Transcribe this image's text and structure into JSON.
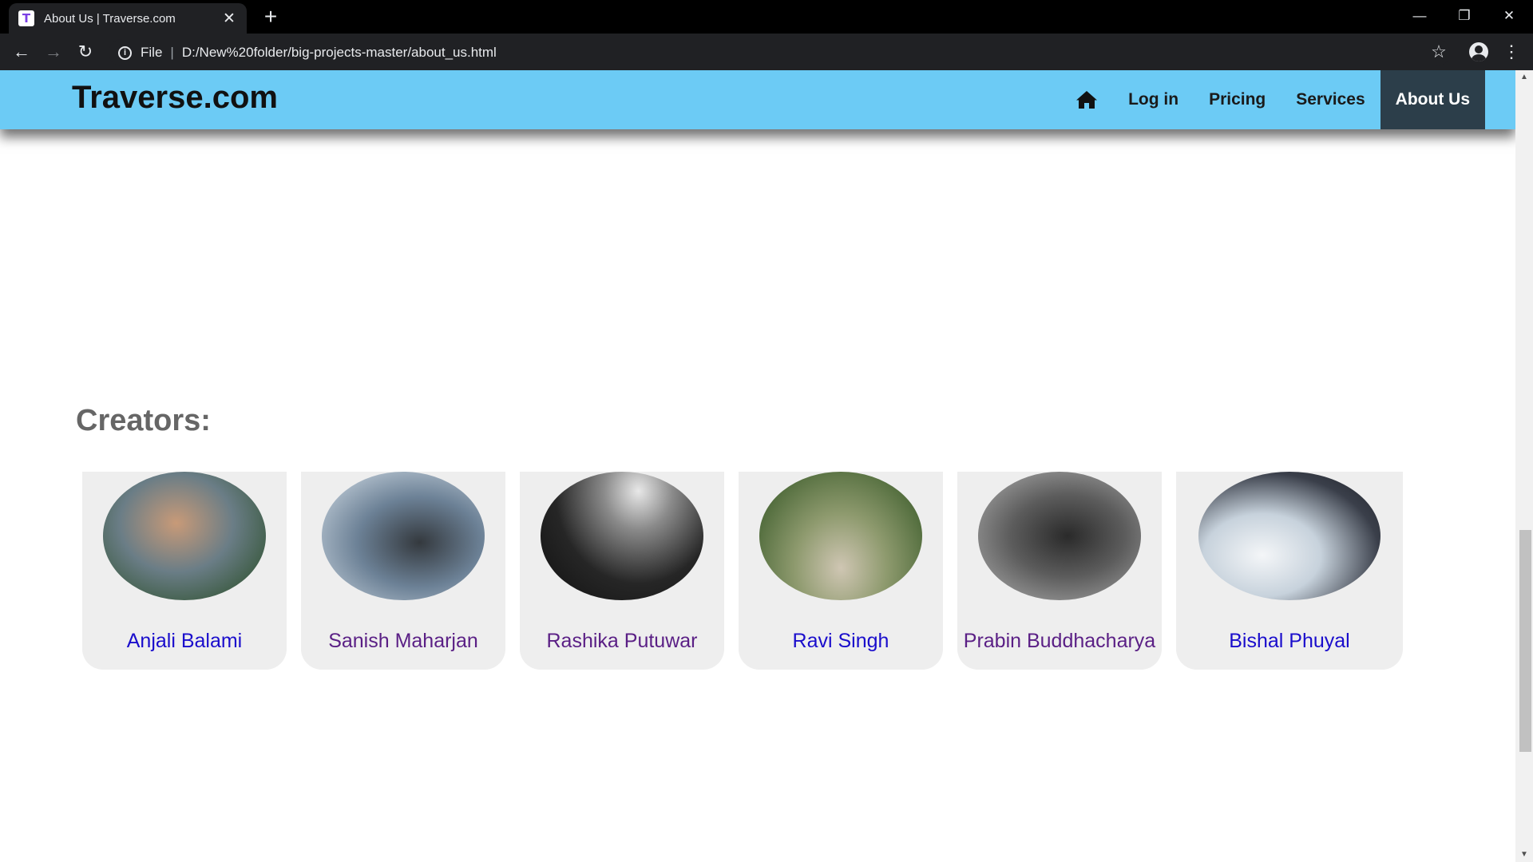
{
  "browser": {
    "tab_title": "About Us | Traverse.com",
    "favicon_glyph": "T",
    "scheme_label": "File",
    "url": "D:/New%20folder/big-projects-master/about_us.html"
  },
  "site": {
    "brand": "Traverse.com",
    "nav": {
      "home_icon": "home-icon",
      "login": "Log in",
      "pricing": "Pricing",
      "services": "Services",
      "about": "About Us"
    },
    "accent_color": "#6ccbf5",
    "active_nav_color": "#2c3e4a"
  },
  "creators": {
    "heading": "Creators:",
    "people": [
      {
        "name": "Anjali Balami",
        "link_state": "unvisited"
      },
      {
        "name": "Sanish Maharjan",
        "link_state": "visited"
      },
      {
        "name": "Rashika Putuwar",
        "link_state": "visited"
      },
      {
        "name": "Ravi Singh",
        "link_state": "unvisited"
      },
      {
        "name": "Prabin Buddhacharya",
        "link_state": "visited"
      },
      {
        "name": "Bishal Phuyal",
        "link_state": "unvisited"
      }
    ]
  }
}
